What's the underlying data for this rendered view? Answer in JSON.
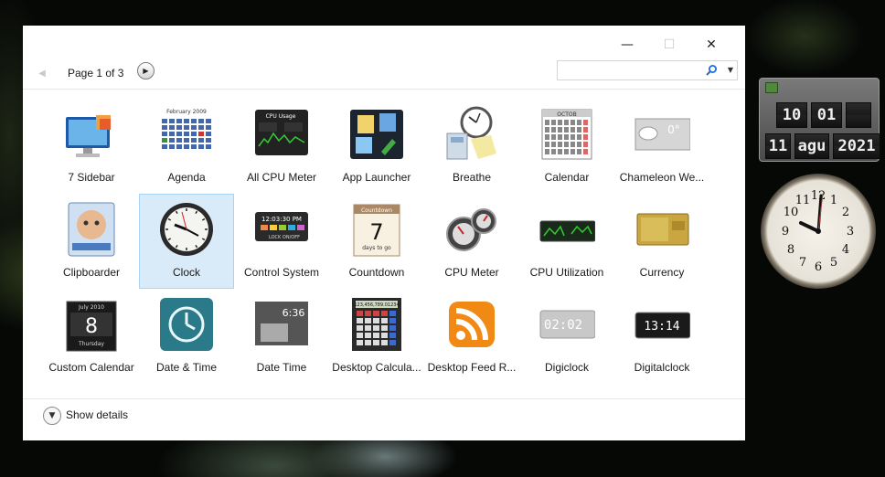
{
  "window": {
    "controls": {
      "minimize": "—",
      "maximize": "☐",
      "close": "✕"
    },
    "page_label": "Page 1 of 3",
    "search": {
      "value": "",
      "placeholder": ""
    },
    "show_details_label": "Show details"
  },
  "gadgets": [
    {
      "label": "7 Sidebar",
      "icon": "sidebar-icon",
      "selected": false
    },
    {
      "label": "Agenda",
      "icon": "calendar-agenda-icon",
      "selected": false
    },
    {
      "label": "All CPU Meter",
      "icon": "cpu-meter-icon",
      "selected": false
    },
    {
      "label": "App Launcher",
      "icon": "app-launcher-icon",
      "selected": false
    },
    {
      "label": "Breathe",
      "icon": "breathe-icon",
      "selected": false
    },
    {
      "label": "Calendar",
      "icon": "calendar-icon",
      "selected": false
    },
    {
      "label": "Chameleon We...",
      "icon": "weather-icon",
      "selected": false
    },
    {
      "label": "Clipboarder",
      "icon": "clipboard-icon",
      "selected": false
    },
    {
      "label": "Clock",
      "icon": "clock-icon",
      "selected": true
    },
    {
      "label": "Control System",
      "icon": "control-system-icon",
      "selected": false
    },
    {
      "label": "Countdown",
      "icon": "countdown-icon",
      "selected": false
    },
    {
      "label": "CPU Meter",
      "icon": "cpu-gauge-icon",
      "selected": false
    },
    {
      "label": "CPU Utilization",
      "icon": "cpu-utilization-icon",
      "selected": false
    },
    {
      "label": "Currency",
      "icon": "currency-icon",
      "selected": false
    },
    {
      "label": "Custom Calendar",
      "icon": "custom-calendar-icon",
      "selected": false
    },
    {
      "label": "Date & Time",
      "icon": "date-time-icon",
      "selected": false
    },
    {
      "label": "Date Time",
      "icon": "digital-date-time-icon",
      "selected": false
    },
    {
      "label": "Desktop Calcula...",
      "icon": "calculator-icon",
      "selected": false
    },
    {
      "label": "Desktop Feed R...",
      "icon": "rss-feed-icon",
      "selected": false
    },
    {
      "label": "Digiclock",
      "icon": "digiclock-icon",
      "selected": false
    },
    {
      "label": "Digitalclock",
      "icon": "digitalclock-icon",
      "selected": false
    }
  ],
  "icon_text": {
    "agenda_title": "February 2009",
    "cpu_title": "CPU Usage",
    "calendar_month": "OCTOB",
    "weather_temp": "0°",
    "control_time": "12:03:30 PM",
    "control_lock": "LOCK ON/OFF",
    "countdown_title": "Countdown",
    "countdown_days": "7",
    "countdown_caption": "days to go",
    "custom_cal_month": "July 2010",
    "custom_cal_day": "8",
    "custom_cal_weekday": "Thursday",
    "datetime_time": "6:36",
    "calc_display": "123,456,789.01234",
    "digiclock_time": "02:02",
    "digitalclock_time": "13:14"
  },
  "desktop_widgets": {
    "flip_clock": {
      "hour": "10",
      "minute": "01",
      "day": "11",
      "month": "agu",
      "year": "2021"
    }
  },
  "colors": {
    "selection_bg": "#d9ebf9",
    "selection_border": "#a9d3f5",
    "search_icon": "#1e6fd0"
  }
}
